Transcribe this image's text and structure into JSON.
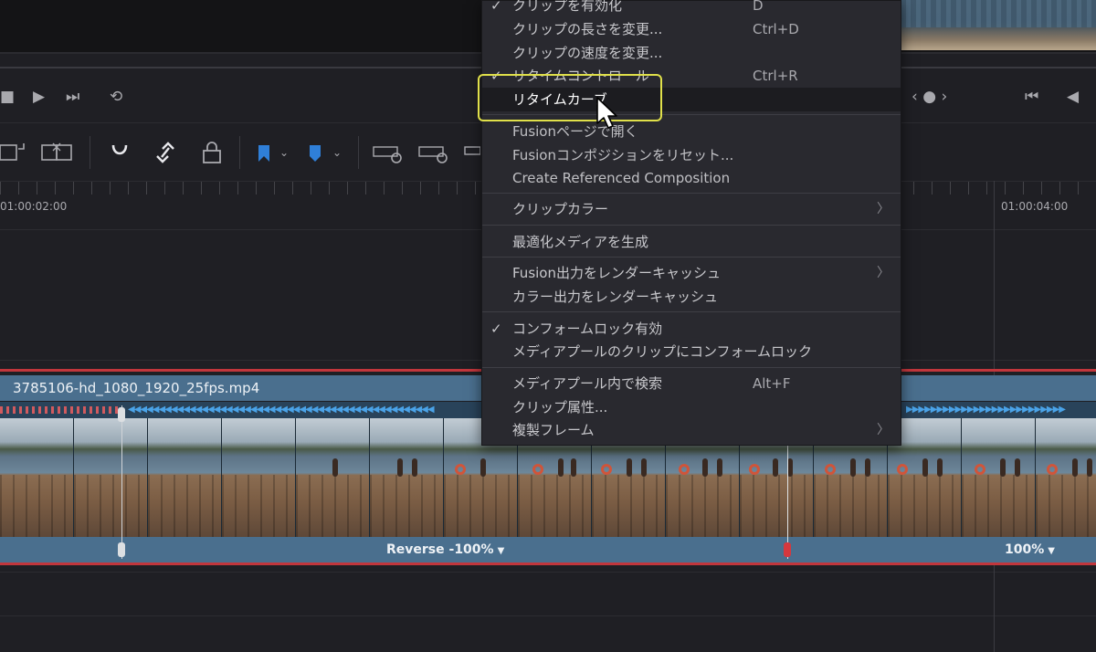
{
  "transport": {
    "stop_icon": "stop-icon",
    "play_icon": "play-icon",
    "next_icon": "skip-forward-icon",
    "loop_icon": "loop-icon",
    "jog_text": "‹ ● ›",
    "back_icon": "skip-back-icon",
    "prev_icon": "step-back-icon"
  },
  "ruler": {
    "timecode_left": "01:00:02:00",
    "timecode_right": "01:00:04:00"
  },
  "clip": {
    "name": "3785106-hd_1080_1920_25fps.mp4",
    "speed_reverse": "Reverse -100%",
    "speed_forward": "100%"
  },
  "menu": {
    "items": [
      {
        "label": "クリップを有効化",
        "shortcut": "D",
        "checked": true
      },
      {
        "label": "クリップの長さを変更...",
        "shortcut": "Ctrl+D"
      },
      {
        "label": "クリップの速度を変更..."
      },
      {
        "label": "リタイムコントロール",
        "shortcut": "Ctrl+R",
        "checked": true
      },
      {
        "label": "リタイムカーブ",
        "highlighted": true
      },
      {
        "label": "Fusionページで開く"
      },
      {
        "label": "Fusionコンポジションをリセット..."
      },
      {
        "label": "Create Referenced Composition"
      },
      {
        "label": "クリップカラー",
        "submenu": true
      },
      {
        "label": "最適化メディアを生成"
      },
      {
        "label": "Fusion出力をレンダーキャッシュ",
        "submenu": true
      },
      {
        "label": "カラー出力をレンダーキャッシュ"
      },
      {
        "label": "コンフォームロック有効",
        "checked": true
      },
      {
        "label": "メディアプールのクリップにコンフォームロック"
      },
      {
        "label": "メディアプール内で検索",
        "shortcut": "Alt+F"
      },
      {
        "label": "クリップ属性..."
      },
      {
        "label": "複製フレーム",
        "submenu": true
      }
    ]
  },
  "colors": {
    "accent_highlight": "#e0e04a",
    "clip_blue": "#4a6f8e",
    "clip_border_red": "#c2363c"
  }
}
